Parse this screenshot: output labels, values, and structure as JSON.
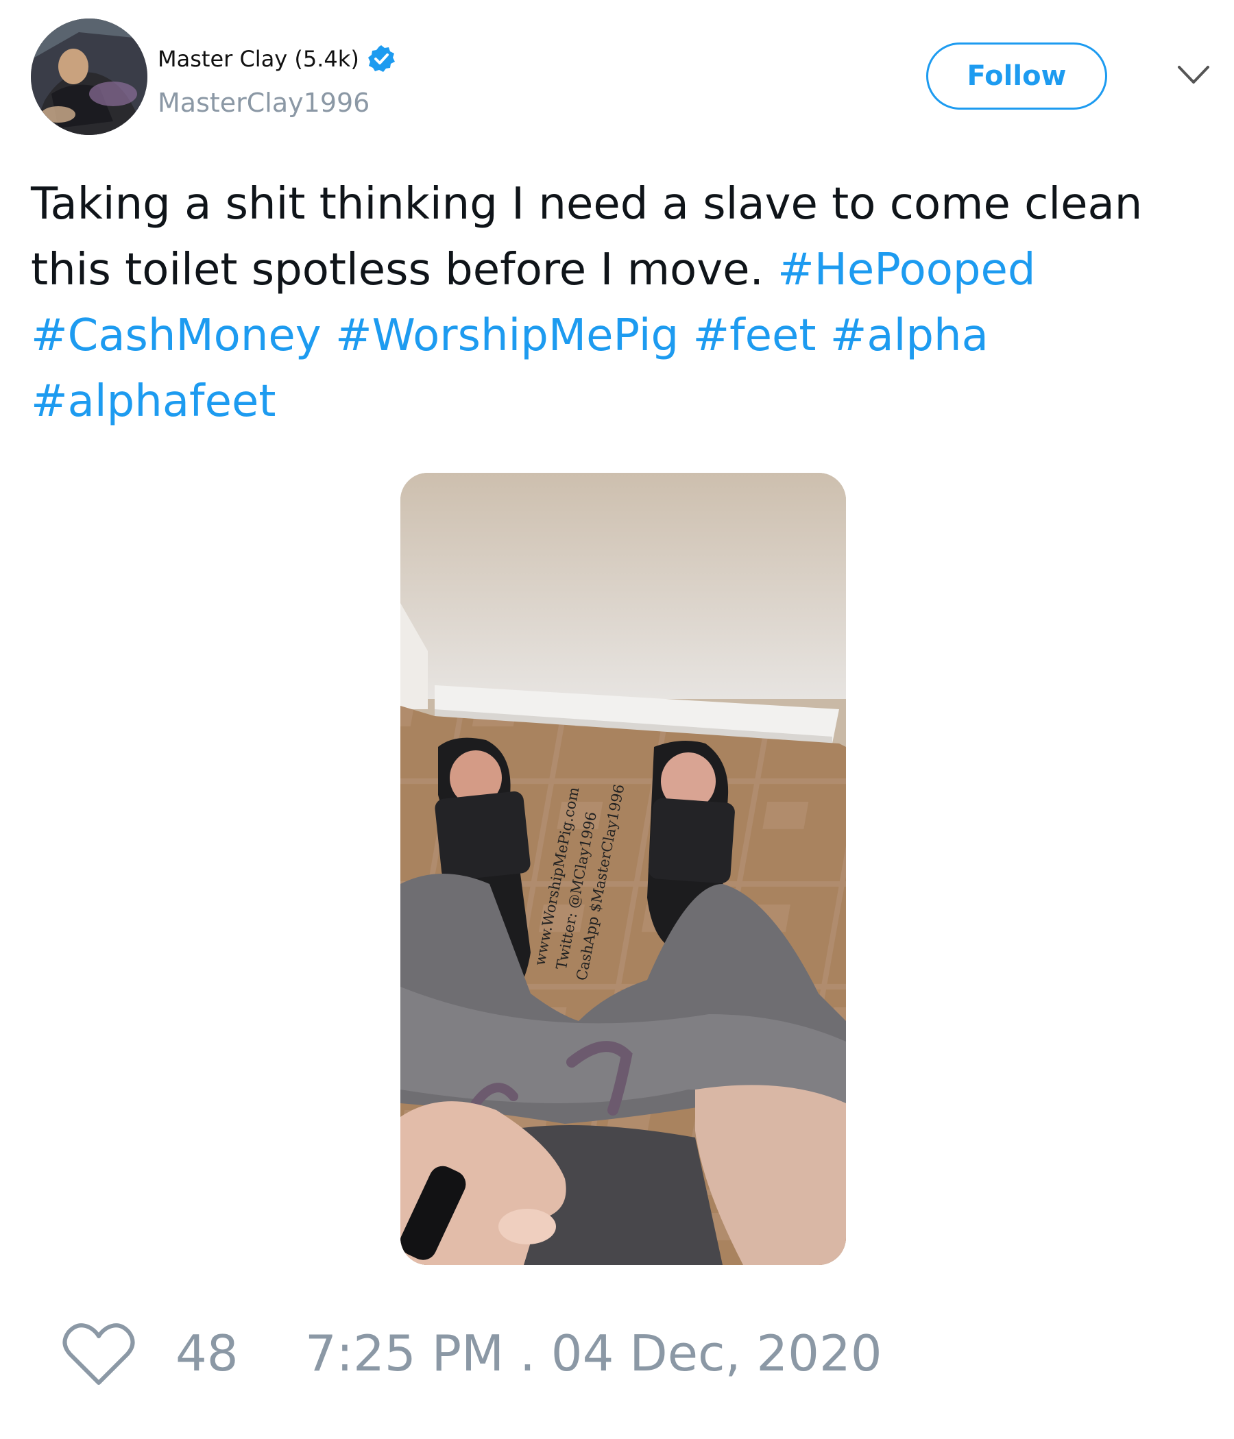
{
  "author": {
    "display_name": "Master Clay (5.4k)",
    "handle": "MasterClay1996",
    "verified": true,
    "avatar_icon": "profile-photo"
  },
  "actions": {
    "follow_label": "Follow",
    "menu_icon": "chevron-down-icon"
  },
  "tweet": {
    "text": "Taking a shit thinking I need a slave to come clean this toilet spotless before I move.",
    "hashtags": [
      "#HePooped",
      "#CashMoney",
      "#WorshipMePig",
      "#feet",
      "#alpha",
      "#alphafeet"
    ]
  },
  "media": {
    "watermark_lines": [
      "www.WorshipMePig.com",
      "Twitter: @MClay1996",
      "CashApp $MasterClay1996"
    ]
  },
  "stats": {
    "likes": "48",
    "timestamp": "7:25 PM . 04 Dec, 2020"
  },
  "colors": {
    "accent": "#1d9bf0",
    "muted": "#8b98a5",
    "text": "#0f1419"
  }
}
